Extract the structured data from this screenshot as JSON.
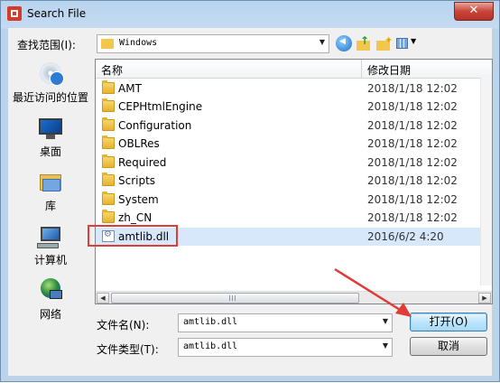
{
  "window": {
    "title": "Search File",
    "close_glyph": "✕"
  },
  "toolbar": {
    "lookin_label": "查找范围(I):",
    "lookin_value": "Windows"
  },
  "places": [
    {
      "label": "最近访问的位置",
      "icon": "recent-places-icon"
    },
    {
      "label": "桌面",
      "icon": "desktop-icon"
    },
    {
      "label": "库",
      "icon": "libraries-icon"
    },
    {
      "label": "计算机",
      "icon": "computer-icon"
    },
    {
      "label": "网络",
      "icon": "network-icon"
    }
  ],
  "columns": {
    "name": "名称",
    "date": "修改日期",
    "sort_glyph": "^"
  },
  "files": [
    {
      "name": "AMT",
      "date": "2018/1/18 12:02",
      "type": "folder"
    },
    {
      "name": "CEPHtmlEngine",
      "date": "2018/1/18 12:02",
      "type": "folder"
    },
    {
      "name": "Configuration",
      "date": "2018/1/18 12:02",
      "type": "folder"
    },
    {
      "name": "OBLRes",
      "date": "2018/1/18 12:02",
      "type": "folder"
    },
    {
      "name": "Required",
      "date": "2018/1/18 12:02",
      "type": "folder"
    },
    {
      "name": "Scripts",
      "date": "2018/1/18 12:02",
      "type": "folder"
    },
    {
      "name": "System",
      "date": "2018/1/18 12:02",
      "type": "folder"
    },
    {
      "name": "zh_CN",
      "date": "2018/1/18 12:02",
      "type": "folder"
    },
    {
      "name": "amtlib.dll",
      "date": "2016/6/2 4:20",
      "type": "dll",
      "selected": true
    }
  ],
  "filename": {
    "label": "文件名(N):",
    "value": "amtlib.dll"
  },
  "filetype": {
    "label": "文件类型(T):",
    "value": "amtlib.dll"
  },
  "buttons": {
    "open": "打开(O)",
    "cancel": "取消"
  },
  "colors": {
    "annotation": "#e03b37",
    "selection": "#d7e8fb"
  }
}
